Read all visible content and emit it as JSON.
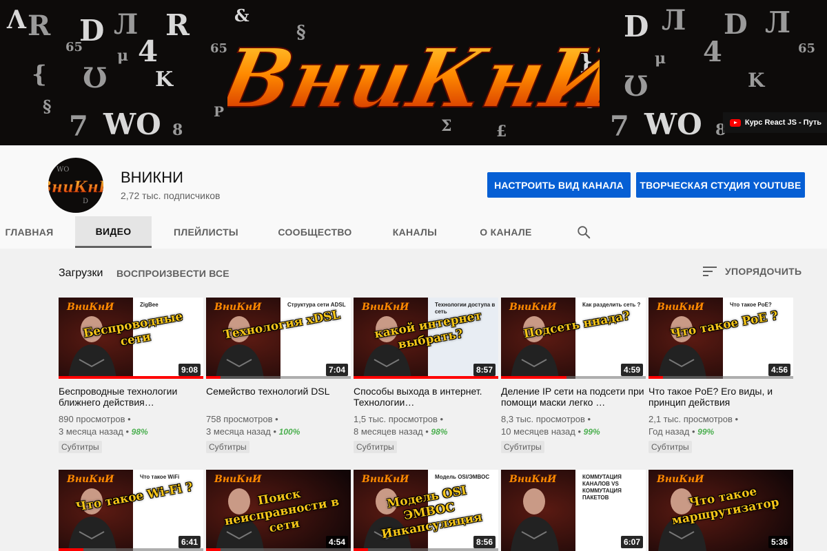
{
  "banner": {
    "logo_text": "ВниКнИ",
    "link_text": "Курс React JS - Путь"
  },
  "channel": {
    "name": "ВНИКНИ",
    "subscribers": "2,72 тыс. подписчиков",
    "customize_button": "НАСТРОИТЬ ВИД КАНАЛА",
    "studio_button": "ТВОРЧЕСКАЯ СТУДИЯ YOUTUBE"
  },
  "tabs": [
    {
      "label": "ГЛАВНАЯ"
    },
    {
      "label": "ВИДЕО"
    },
    {
      "label": "ПЛЕЙЛИСТЫ"
    },
    {
      "label": "СООБЩЕСТВО"
    },
    {
      "label": "КАНАЛЫ"
    },
    {
      "label": "О КАНАЛЕ"
    }
  ],
  "shelf": {
    "title": "Загрузки",
    "play_all": "ВОСПРОИЗВЕСТИ ВСЕ",
    "sort_label": "УПОРЯДОЧИТЬ"
  },
  "videos": [
    {
      "title": "Беспроводные технологии ближнего действия…",
      "views": "890 просмотров",
      "age": "3 месяца назад",
      "rating": "98%",
      "badge": "Субтитры",
      "duration": "9:08",
      "progress": 1.0,
      "overlay": "Беспроводные сети",
      "side": "ZigBee"
    },
    {
      "title": "Семейство технологий DSL",
      "views": "758 просмотров",
      "age": "3 месяца назад",
      "rating": "100%",
      "badge": "Субтитры",
      "duration": "7:04",
      "progress": 0.1,
      "overlay": "Технология xDSL",
      "side": "Структура сети ADSL"
    },
    {
      "title": "Способы выхода в интернет. Технологии…",
      "views": "1,5 тыс. просмотров",
      "age": "8 месяцев назад",
      "rating": "98%",
      "badge": "Субтитры",
      "duration": "8:57",
      "progress": 1.0,
      "overlay": "какой интернет выбрать?",
      "side": "Технологии доступа в сеть"
    },
    {
      "title": "Деление IP сети на подсети при помощи маски легко …",
      "views": "8,3 тыс. просмотров",
      "age": "10 месяцев назад",
      "rating": "99%",
      "badge": "Субтитры",
      "duration": "4:59",
      "progress": 0.45,
      "overlay": "Подсеть ннада?",
      "side": "Как разделить сеть ?"
    },
    {
      "title": "Что такое PoE? Его виды, и принцип действия",
      "views": "2,1 тыс. просмотров",
      "age": "Год назад",
      "rating": "99%",
      "badge": "Субтитры",
      "duration": "4:56",
      "progress": 0.1,
      "overlay": "Что такое PoE ?",
      "side": "Что такое PoE?"
    },
    {
      "title": "",
      "views": "",
      "age": "",
      "rating": "",
      "badge": "",
      "duration": "6:41",
      "progress": 0.17,
      "overlay": "Что такое Wi-Fi ?",
      "side": "Что такое WiFi"
    },
    {
      "title": "",
      "views": "",
      "age": "",
      "rating": "",
      "badge": "",
      "duration": "4:54",
      "progress": 0.1,
      "overlay": "Поиск неисправности в сети",
      "side": ""
    },
    {
      "title": "",
      "views": "",
      "age": "",
      "rating": "",
      "badge": "",
      "duration": "8:56",
      "progress": 0.1,
      "overlay": "Модель OSI ЭМВОС Инкапсуляция",
      "side": "Модель OSI/ЭМВОС"
    },
    {
      "title": "",
      "views": "",
      "age": "",
      "rating": "",
      "badge": "",
      "duration": "6:07",
      "progress": 0.0,
      "overlay": "",
      "side": "КОММУТАЦИЯ КАНАЛОВ VS КОММУТАЦИЯ ПАКЕТОВ"
    },
    {
      "title": "",
      "views": "",
      "age": "",
      "rating": "",
      "badge": "",
      "duration": "5:36",
      "progress": 0.0,
      "overlay": "Что такое маршрутизатор",
      "side": ""
    }
  ],
  "colors": {
    "accent": "#065fd4",
    "progress": "#ff0000",
    "rating": "#4caf50",
    "overlay_text": "#f5c518"
  }
}
